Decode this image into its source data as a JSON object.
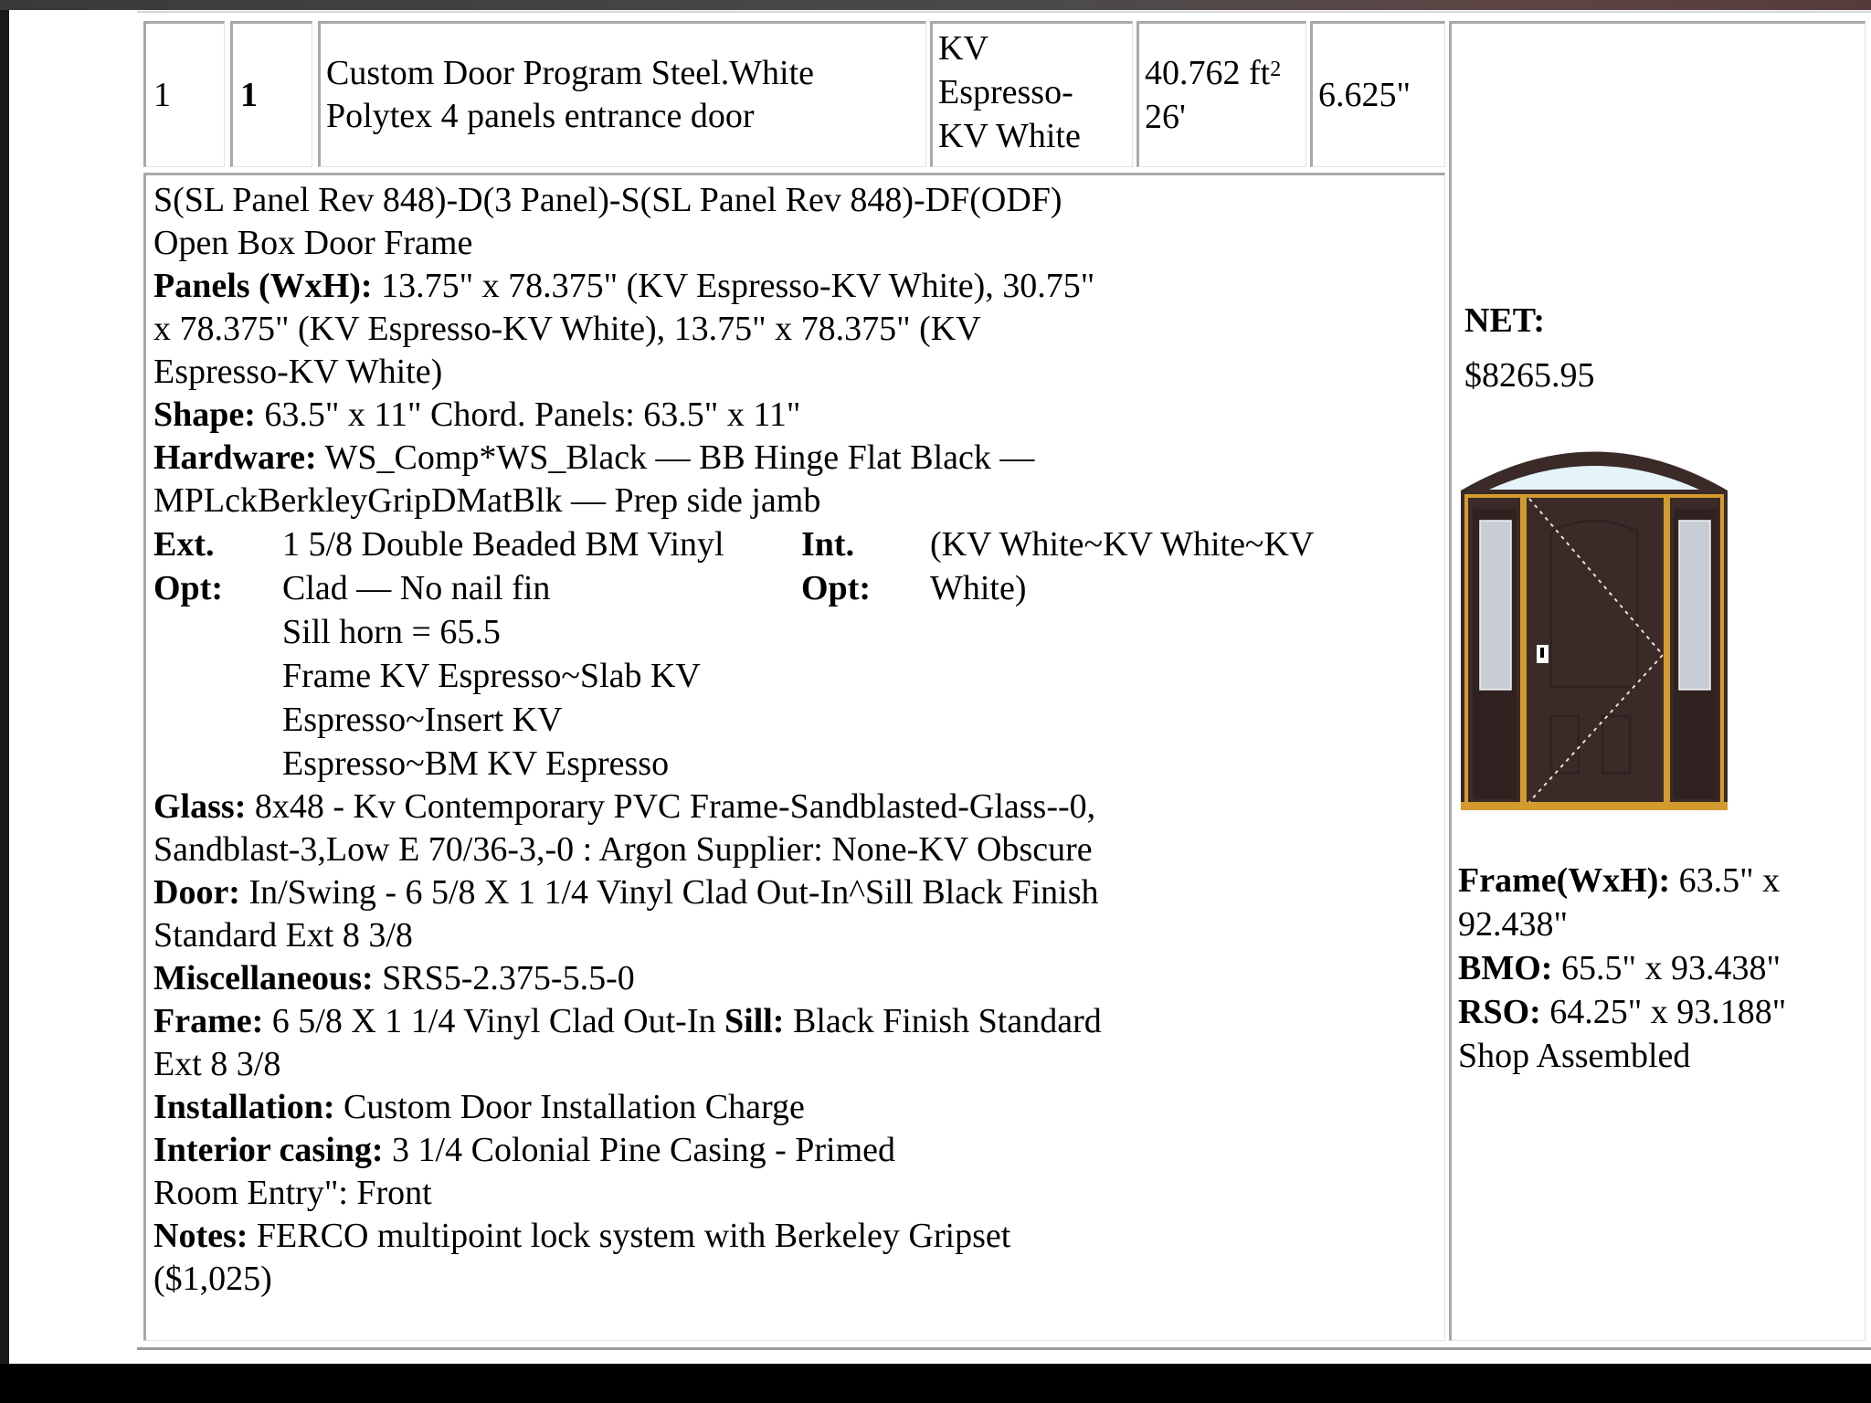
{
  "row": {
    "line_no": "1",
    "qty": "1",
    "description_line1": "Custom Door Program Steel.White",
    "description_line2": "Polytex 4 panels entrance door",
    "color_line1": "KV",
    "color_line2": "Espresso-",
    "color_line3": "KV White",
    "area_value": "40.762 ft",
    "area_sup": "2",
    "area_line2": "26'",
    "depth": "6.625\""
  },
  "detail": {
    "config": "S(SL Panel Rev 848)-D(3 Panel)-S(SL Panel Rev 848)-DF(ODF)",
    "frame_type": "Open Box Door Frame",
    "panels_label": "Panels (WxH):",
    "panels_text_1": " 13.75\" x 78.375\" (KV Espresso-KV White), 30.75\"",
    "panels_text_2": "x 78.375\" (KV Espresso-KV White), 13.75\" x 78.375\" (KV",
    "panels_text_3": "Espresso-KV White)",
    "shape_label": "Shape:",
    "shape_text": " 63.5\" x 11\" Chord. Panels: 63.5\" x 11\"",
    "hardware_label": "Hardware:",
    "hardware_text_1": " WS_Comp*WS_Black — BB Hinge Flat Black —",
    "hardware_text_2": "MPLckBerkleyGripDMatBlk — Prep side jamb",
    "ext_opt_label_1": "Ext.",
    "ext_opt_label_2": "Opt:",
    "ext_opt_lines": [
      "1 5/8 Double Beaded BM Vinyl",
      "Clad — No nail fin",
      "Sill horn = 65.5",
      "Frame KV Espresso~Slab KV",
      "Espresso~Insert KV",
      "Espresso~BM KV Espresso"
    ],
    "int_opt_label_1": "Int.",
    "int_opt_label_2": "Opt:",
    "int_opt_lines": [
      "(KV White~KV White~KV",
      "White)"
    ],
    "glass_label": "Glass:",
    "glass_text_1": " 8x48 - Kv Contemporary PVC Frame-Sandblasted-Glass--0,",
    "glass_text_2": "Sandblast-3,Low E 70/36-3,-0 : Argon Supplier: None-KV Obscure",
    "door_label": "Door:",
    "door_text_1": " In/Swing - 6 5/8 X 1 1/4 Vinyl Clad Out-In^Sill Black Finish",
    "door_text_2": "Standard Ext 8 3/8",
    "misc_label": "Miscellaneous:",
    "misc_text": " SRS5-2.375-5.5-0",
    "frame_label": "Frame:",
    "frame_text": " 6 5/8 X 1 1/4 Vinyl Clad Out-In ",
    "sill_label": "Sill:",
    "sill_text_1": " Black Finish Standard",
    "sill_text_2": "Ext 8 3/8",
    "installation_label": "Installation:",
    "installation_text": " Custom Door Installation Charge",
    "casing_label": "Interior casing:",
    "casing_text": " 3 1/4 Colonial Pine Casing - Primed",
    "room_entry": "Room Entry\": Front",
    "notes_label": "Notes:",
    "notes_text_1": " FERCO multipoint lock system with Berkeley Gripset",
    "notes_text_2": "($1,025)"
  },
  "summary": {
    "net_label": "NET:",
    "net_value": "$8265.95",
    "frame_label": "Frame(WxH):",
    "frame_value_1": " 63.5\" x",
    "frame_value_2": "92.438\"",
    "bmo_label": "BMO:",
    "bmo_value": " 65.5\" x 93.438\"",
    "rso_label": "RSO:",
    "rso_value": " 64.25\" x 93.188\"",
    "assembly": "Shop Assembled"
  },
  "colors": {
    "door_brown": "#3a2a28",
    "frame_gold": "#d39a2e",
    "glass": "#c9ced6",
    "transom_glass": "#e4f4fa"
  }
}
